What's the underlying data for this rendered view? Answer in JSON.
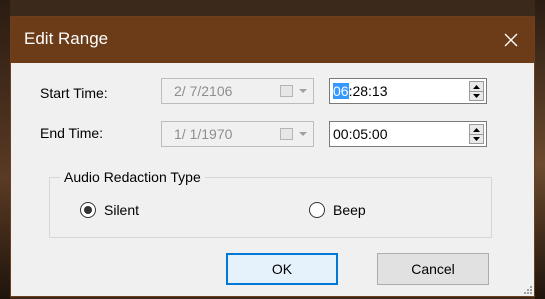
{
  "dialog": {
    "title": "Edit Range",
    "close_icon": "close-icon",
    "start": {
      "label": "Start Time:",
      "date": "2/  7/2106",
      "time_selected": "06",
      "time_rest": ":28:13"
    },
    "end": {
      "label": "End Time:",
      "date": "1/  1/1970",
      "time": "00:05:00"
    },
    "audio": {
      "group_label": "Audio Redaction Type",
      "silent_label": "Silent",
      "beep_label": "Beep",
      "selected": "Silent"
    },
    "buttons": {
      "ok": "OK",
      "cancel": "Cancel"
    }
  },
  "colors": {
    "titlebar": "#6c3b18",
    "selection": "#3399ff",
    "default_button_border": "#0078d7"
  }
}
